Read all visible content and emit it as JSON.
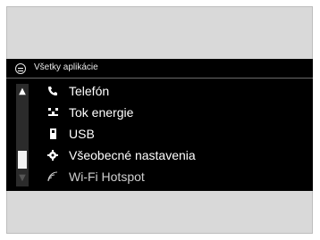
{
  "header": {
    "title": "Všetky aplikácie",
    "icon": "apps-icon"
  },
  "menu": {
    "items": [
      {
        "label": "Telefón",
        "icon": "phone-icon"
      },
      {
        "label": "Tok energie",
        "icon": "energy-flow-icon"
      },
      {
        "label": "USB",
        "icon": "usb-icon"
      },
      {
        "label": "Všeobecné nastavenia",
        "icon": "gear-icon"
      },
      {
        "label": "Wi-Fi Hotspot",
        "icon": "wifi-icon"
      }
    ]
  },
  "scrollbar": {
    "up_glyph": "▲",
    "down_glyph": "▼"
  },
  "colors": {
    "screen_bg": "#000000",
    "text": "#ffffff",
    "frame_bg": "#d9d9d9"
  }
}
